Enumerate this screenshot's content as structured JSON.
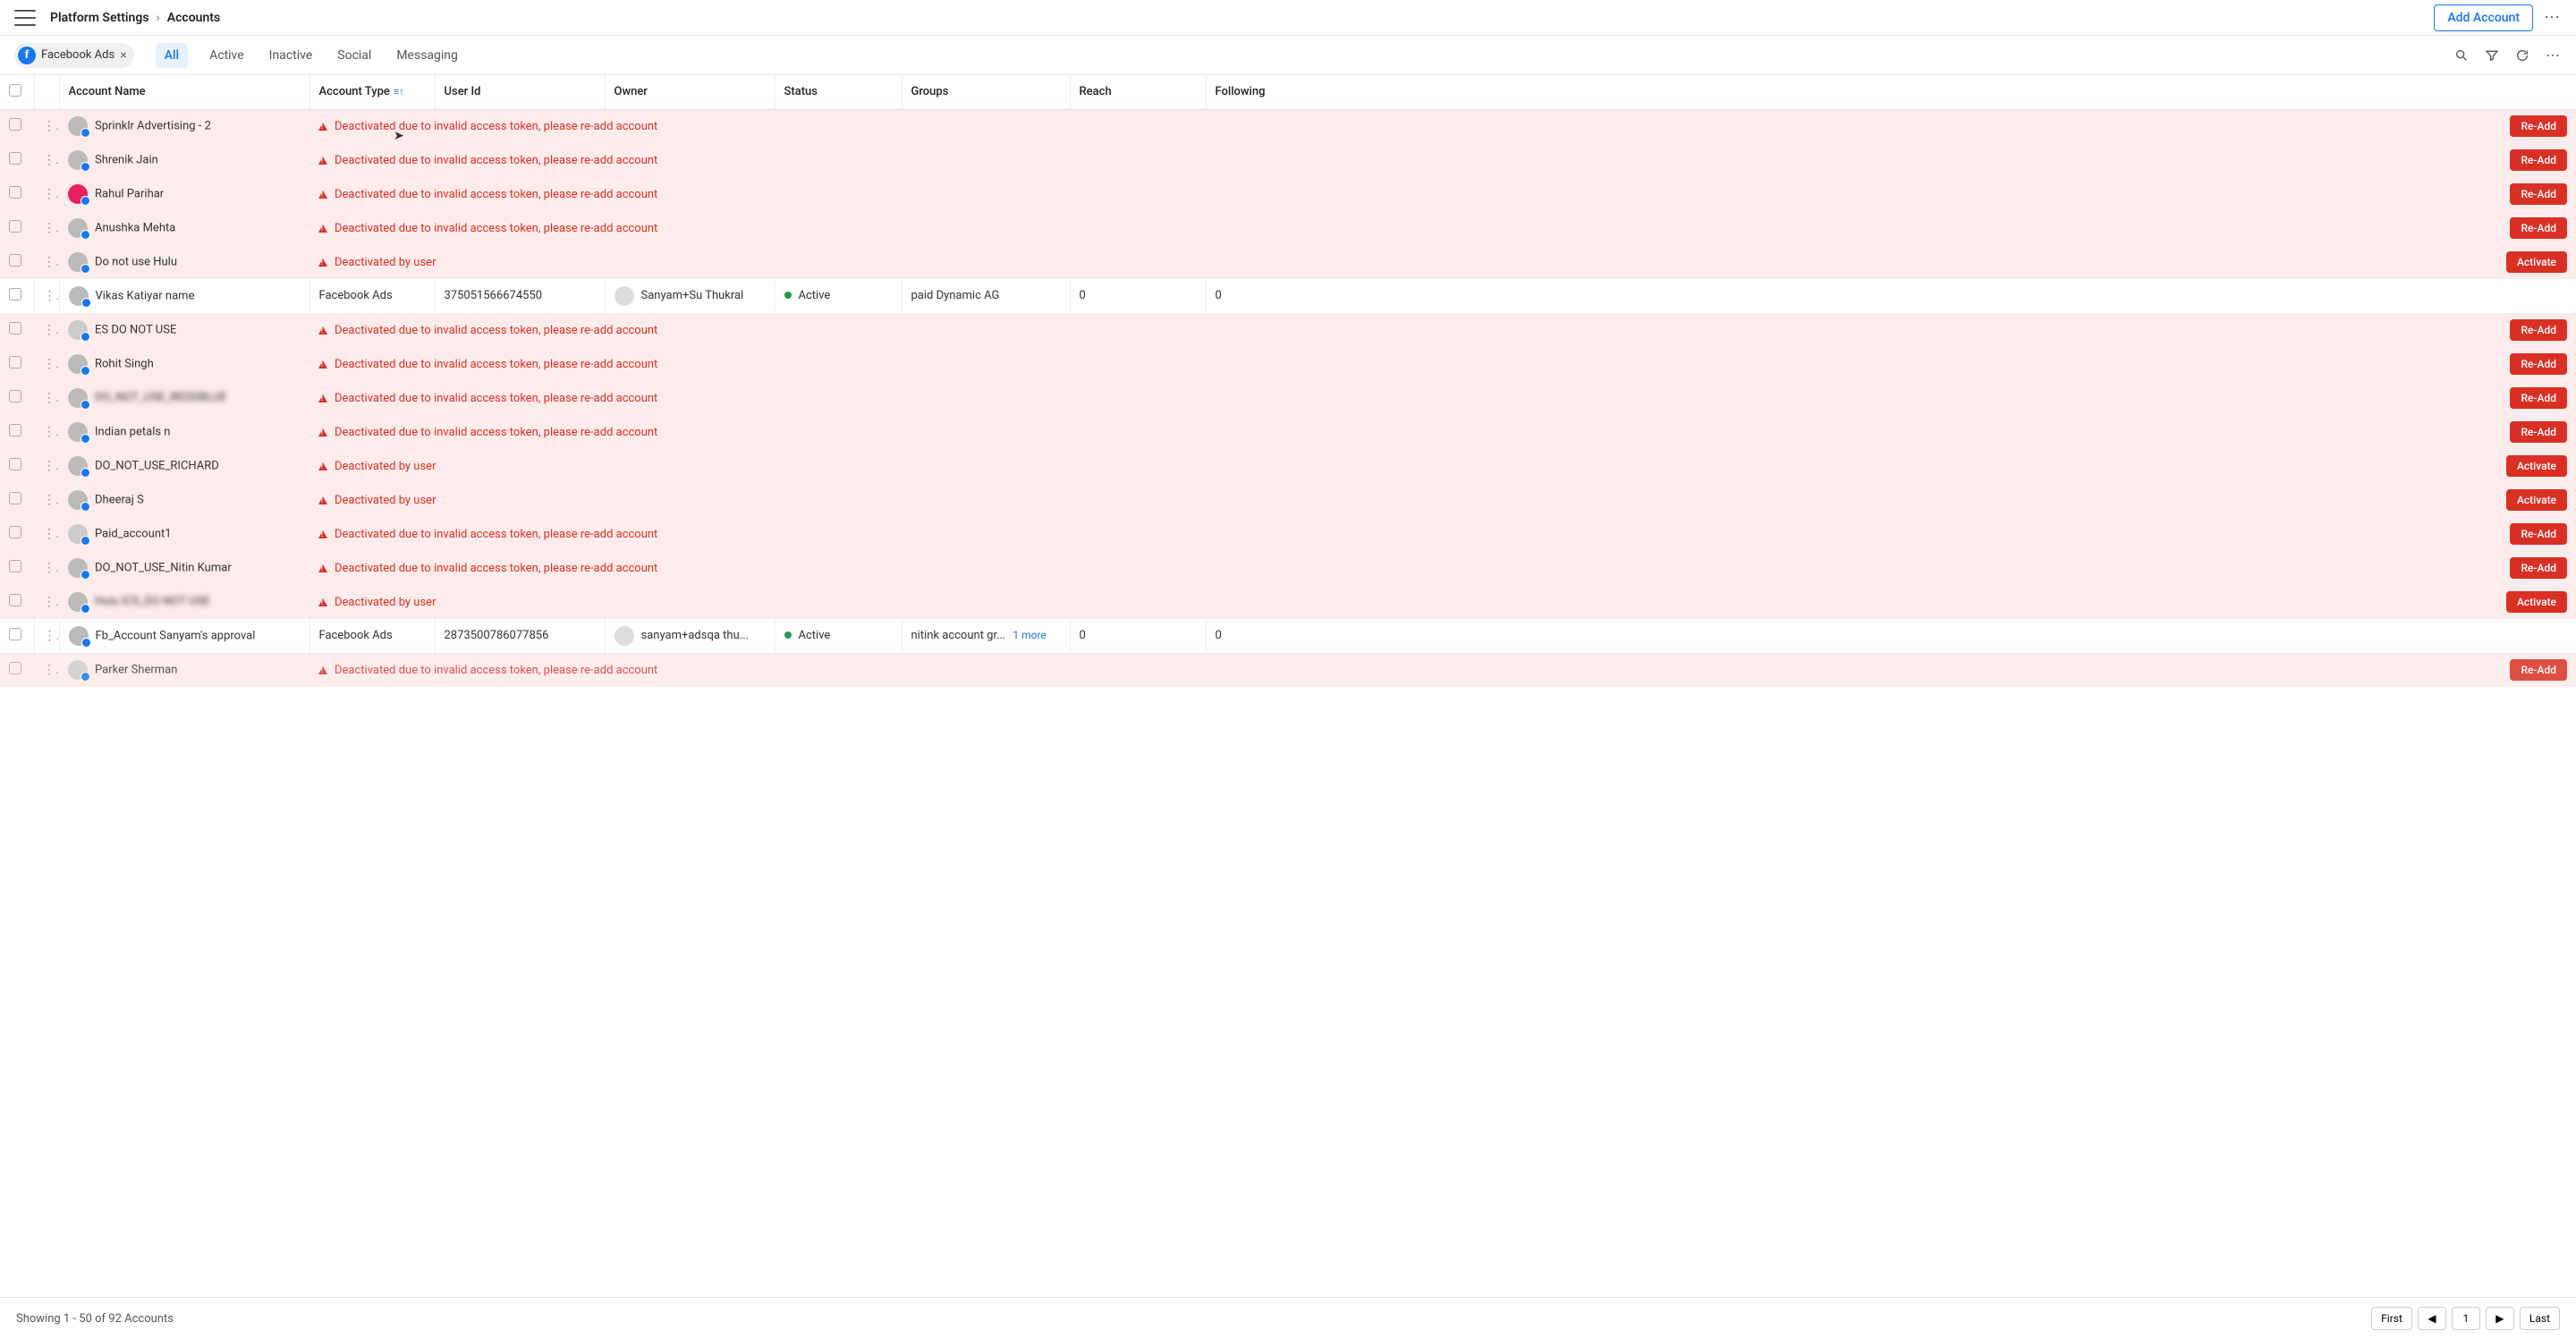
{
  "header": {
    "breadcrumb_parent": "Platform Settings",
    "breadcrumb_current": "Accounts",
    "add_button": "Add Account"
  },
  "filter": {
    "chip_label": "Facebook Ads",
    "tabs": [
      "All",
      "Active",
      "Inactive",
      "Social",
      "Messaging"
    ],
    "active_tab": 0
  },
  "columns": {
    "name": "Account Name",
    "type": "Account Type",
    "user_id": "User Id",
    "owner": "Owner",
    "status": "Status",
    "groups": "Groups",
    "reach": "Reach",
    "following": "Following"
  },
  "messages": {
    "invalid_token": "Deactivated due to invalid access token, please re-add account",
    "by_user": "Deactivated by user"
  },
  "actions": {
    "readd": "Re-Add",
    "activate": "Activate"
  },
  "rows": [
    {
      "name": "Sprinklr Advertising - 2",
      "state": "invalid",
      "action": "readd",
      "avatar": ""
    },
    {
      "name": "Shrenik Jain",
      "state": "invalid",
      "action": "readd",
      "avatar": ""
    },
    {
      "name": "Rahul Parihar",
      "state": "invalid",
      "action": "readd",
      "avatar": "pink"
    },
    {
      "name": "Anushka Mehta",
      "state": "invalid",
      "action": "readd",
      "avatar": ""
    },
    {
      "name": "Do not use Hulu",
      "state": "byuser",
      "action": "activate",
      "avatar": ""
    },
    {
      "name": "Vikas Katiyar name",
      "state": "active",
      "type": "Facebook Ads",
      "user_id": "375051566674550",
      "owner": "Sanyam+Su Thukral",
      "status": "Active",
      "groups": "paid Dynamic AG",
      "reach": "0",
      "following": "0",
      "avatar": ""
    },
    {
      "name": "ES DO NOT USE",
      "state": "invalid",
      "action": "readd",
      "avatar": "grey"
    },
    {
      "name": "Rohit Singh",
      "state": "invalid",
      "action": "readd",
      "avatar": ""
    },
    {
      "name": "DO_NOT_USE_REDDBLUE",
      "state": "invalid",
      "action": "readd",
      "blur": true,
      "avatar": ""
    },
    {
      "name": "Indian petals n",
      "state": "invalid",
      "action": "readd",
      "avatar": ""
    },
    {
      "name": "DO_NOT_USE_RICHARD",
      "state": "byuser",
      "action": "activate",
      "avatar": ""
    },
    {
      "name": "Dheeraj S",
      "state": "byuser",
      "action": "activate",
      "avatar": ""
    },
    {
      "name": "Paid_account1",
      "state": "invalid",
      "action": "readd",
      "avatar": "grey"
    },
    {
      "name": "DO_NOT_USE_Nitin Kumar",
      "state": "invalid",
      "action": "readd",
      "avatar": ""
    },
    {
      "name": "Hulu ICS_DO NOT USE",
      "state": "byuser",
      "action": "activate",
      "blur": true,
      "avatar": ""
    },
    {
      "name": "Fb_Account Sanyam's approval",
      "state": "active",
      "type": "Facebook Ads",
      "user_id": "2873500786077856",
      "owner": "sanyam+adsqa thu...",
      "status": "Active",
      "groups": "nitink account gr...",
      "groups_more": "1 more",
      "reach": "0",
      "following": "0",
      "avatar": ""
    },
    {
      "name": "Parker Sherman",
      "state": "invalid",
      "action": "readd",
      "avatar": "grey",
      "cutoff": true
    }
  ],
  "footer": {
    "showing": "Showing 1 - 50 of 92 Accounts",
    "first": "First",
    "last": "Last",
    "page": "1"
  }
}
